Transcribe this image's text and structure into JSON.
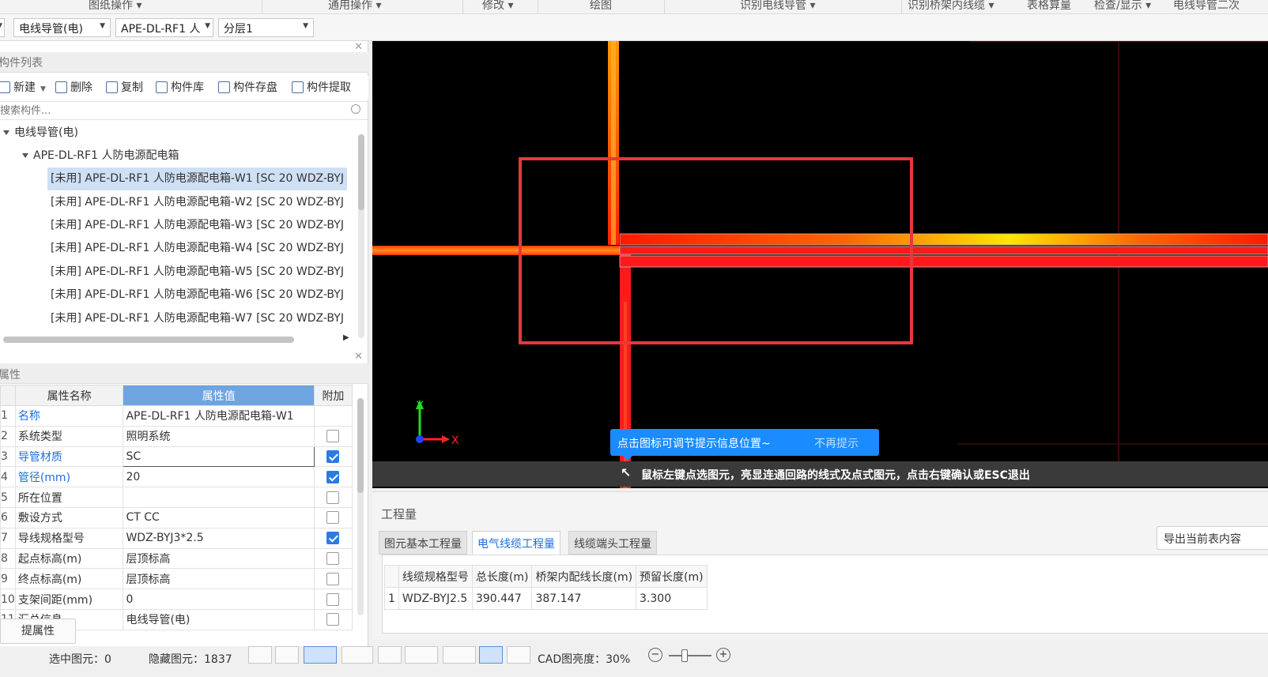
{
  "ribbon": {
    "items": [
      "图纸操作 ▾",
      "通用操作 ▾",
      "修改 ▾",
      "绘图",
      "识别电线导管 ▾",
      "识别桥架内线缆 ▾",
      "表格算量",
      "检查/显示 ▾",
      "电线导管二次"
    ]
  },
  "combos": {
    "category": "电线导管(电)",
    "component": "APE-DL-RF1 人",
    "layer": "分层1"
  },
  "component_list": {
    "title": "构件列表",
    "toolbar": {
      "new": "新建",
      "delete": "删除",
      "copy": "复制",
      "library": "构件库",
      "save": "构件存盘",
      "extract": "构件提取"
    },
    "search_placeholder": "搜索构件...",
    "root": "电线导管(电)",
    "group": "APE-DL-RF1 人防电源配电箱",
    "items": [
      "[未用] APE-DL-RF1 人防电源配电箱-W1 [SC 20 WDZ-BYJ",
      "[未用] APE-DL-RF1 人防电源配电箱-W2 [SC 20 WDZ-BYJ",
      "[未用] APE-DL-RF1 人防电源配电箱-W3 [SC 20 WDZ-BYJ",
      "[未用] APE-DL-RF1 人防电源配电箱-W4 [SC 20 WDZ-BYJ",
      "[未用] APE-DL-RF1 人防电源配电箱-W5 [SC 20 WDZ-BYJ",
      "[未用] APE-DL-RF1 人防电源配电箱-W6 [SC 20 WDZ-BYJ",
      "[未用] APE-DL-RF1 人防电源配电箱-W7 [SC 20 WDZ-BYJ"
    ]
  },
  "properties": {
    "title": "属性",
    "headers": {
      "name": "属性名称",
      "value": "属性值",
      "extra": "附加"
    },
    "rows": [
      {
        "idx": "1",
        "name": "名称",
        "value": "APE-DL-RF1 人防电源配电箱-W1",
        "blue": true,
        "check": null
      },
      {
        "idx": "2",
        "name": "系统类型",
        "value": "照明系统",
        "blue": false,
        "check": false
      },
      {
        "idx": "3",
        "name": "导管材质",
        "value": "SC",
        "blue": true,
        "check": true
      },
      {
        "idx": "4",
        "name": "管径(mm)",
        "value": "20",
        "blue": true,
        "check": true
      },
      {
        "idx": "5",
        "name": "所在位置",
        "value": "",
        "blue": false,
        "check": false
      },
      {
        "idx": "6",
        "name": "敷设方式",
        "value": "CT   CC",
        "blue": false,
        "check": false
      },
      {
        "idx": "7",
        "name": "导线规格型号",
        "value": "WDZ-BYJ3*2.5",
        "blue": false,
        "check": true
      },
      {
        "idx": "8",
        "name": "起点标高(m)",
        "value": "层顶标高",
        "blue": false,
        "check": false
      },
      {
        "idx": "9",
        "name": "终点标高(m)",
        "value": "层顶标高",
        "blue": false,
        "check": false
      },
      {
        "idx": "10",
        "name": "支架间距(mm)",
        "value": "0",
        "blue": false,
        "check": false
      },
      {
        "idx": "11",
        "name": "汇总信息",
        "value": "电线导管(电)",
        "blue": false,
        "check": false
      }
    ],
    "pick_button": "提属性"
  },
  "canvas": {
    "axis_x": "X",
    "axis_y": "Y",
    "tooltip": "点击图标可调节提示信息位置~",
    "tooltip_dismiss": "不再提示",
    "status_message": "鼠标左键点选图元，亮显连通回路的线式及点式图元，点击右键确认或ESC退出"
  },
  "quantity": {
    "title": "工程量",
    "tabs": [
      "图元基本工程量",
      "电气线缆工程量",
      "线缆端头工程量"
    ],
    "active_tab": 1,
    "export_button": "导出当前表内容",
    "columns": [
      "",
      "线缆规格型号",
      "总长度(m)",
      "桥架内配线长度(m)",
      "预留长度(m)"
    ],
    "rows": [
      [
        "1",
        "WDZ-BYJ2.5",
        "390.447",
        "387.147",
        "3.300"
      ]
    ]
  },
  "statusbar": {
    "selected": "选中图元：0",
    "hidden": "隐藏图元：1837",
    "cad_brightness": "CAD图亮度：30%"
  },
  "colors": {
    "accent": "#1a8cff",
    "selection_box": "#e8373d",
    "pipe_red": "#ff1a1a",
    "pipe_highlight": "#ffe81a"
  }
}
